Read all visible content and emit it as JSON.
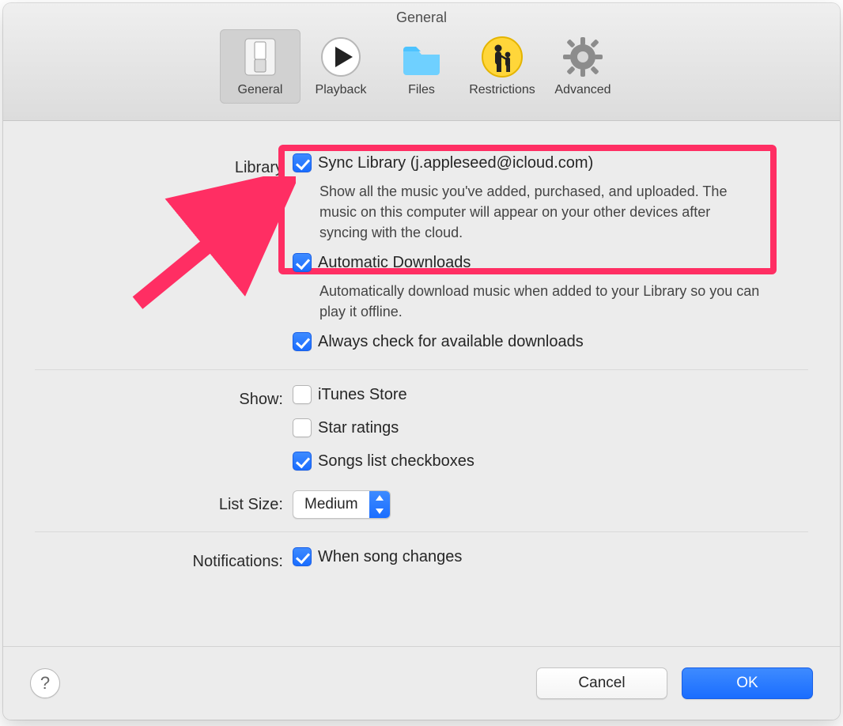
{
  "window": {
    "title": "General"
  },
  "tabs": [
    {
      "id": "general",
      "label": "General",
      "selected": true
    },
    {
      "id": "playback",
      "label": "Playback",
      "selected": false
    },
    {
      "id": "files",
      "label": "Files",
      "selected": false
    },
    {
      "id": "restrictions",
      "label": "Restrictions",
      "selected": false
    },
    {
      "id": "advanced",
      "label": "Advanced",
      "selected": false
    }
  ],
  "sections": {
    "library": {
      "label": "Library",
      "sync": {
        "label": "Sync Library (j.appleseed@icloud.com)",
        "checked": true,
        "desc": "Show all the music you've added, purchased, and uploaded. The music on this computer will appear on your other devices after syncing with the cloud."
      },
      "autoDownloads": {
        "label": "Automatic Downloads",
        "checked": true,
        "desc": "Automatically download music when added to your Library so you can play it offline."
      },
      "checkDownloads": {
        "label": "Always check for available downloads",
        "checked": true
      }
    },
    "show": {
      "label": "Show:",
      "itunesStore": {
        "label": "iTunes Store",
        "checked": false
      },
      "starRatings": {
        "label": "Star ratings",
        "checked": false
      },
      "songCheckboxes": {
        "label": "Songs list checkboxes",
        "checked": true
      }
    },
    "listSize": {
      "label": "List Size:",
      "value": "Medium"
    },
    "notifications": {
      "label": "Notifications:",
      "songChanges": {
        "label": "When song changes",
        "checked": true
      }
    }
  },
  "footer": {
    "help": "?",
    "cancel": "Cancel",
    "ok": "OK"
  },
  "annotation": {
    "highlight": "sync-library-setting",
    "color": "#ff2e63"
  }
}
